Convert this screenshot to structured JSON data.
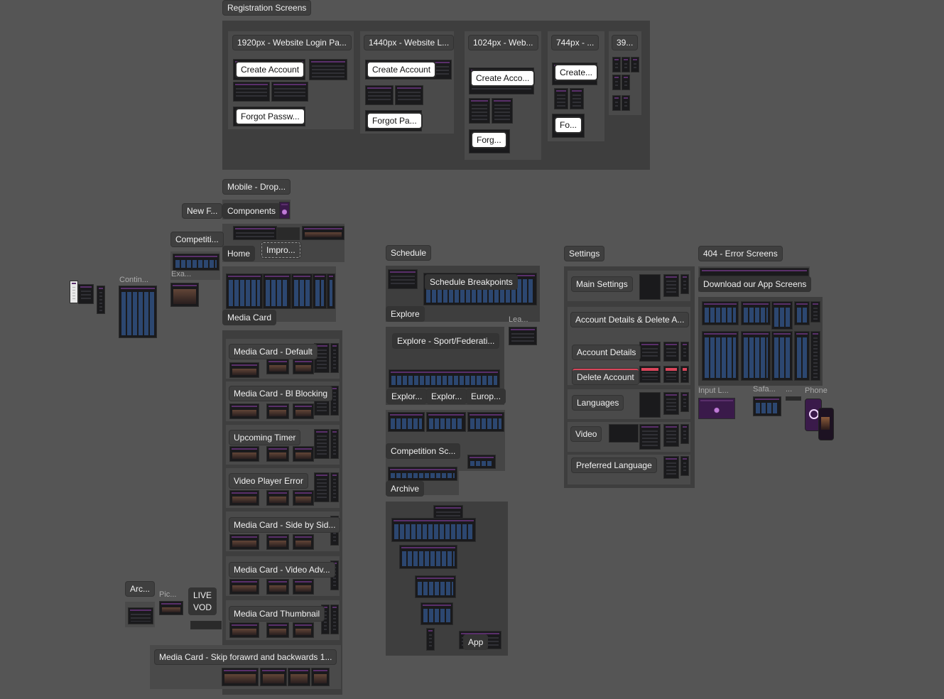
{
  "sections": {
    "registration": {
      "title": "Registration Screens",
      "frames": [
        {
          "title": "1920px - Website Login Pa...",
          "create": "Create Account",
          "forgot": "Forgot Passw..."
        },
        {
          "title": "1440px - Website L...",
          "create": "Create Account",
          "forgot": "Forgot Pa..."
        },
        {
          "title": "1024px - Web...",
          "create": "Create Acco...",
          "forgot": "Forg..."
        },
        {
          "title": "744px - ...",
          "create": "Create...",
          "forgot": "Fo..."
        },
        {
          "title": "39..."
        }
      ]
    },
    "components": {
      "mobile_drop": "Mobile - Drop...",
      "new_f": "New F...",
      "components": "Components",
      "competiti": "Competiti...",
      "home": "Home",
      "impro": "Impro...",
      "exa": "Exa...",
      "contin": "Contin...",
      "media_card": "Media Card",
      "media_card_groups": [
        "Media Card - Default",
        "Media Card - Bl Blocking",
        "Upcoming Timer",
        "Video Player Error",
        "Media Card - Side by Sid...",
        "Media Card - Video Adv...",
        "Media Card Thumbnail"
      ],
      "skip_card": "Media Card - Skip forawrd and backwards 1...",
      "arc": "Arc...",
      "pic": "Pic...",
      "live": "LIVE",
      "vod": "VOD"
    },
    "schedule": {
      "title": "Schedule",
      "breakpoints": "Schedule Breakpoints",
      "explore": "Explore",
      "lea": "Lea...",
      "explore_sport": "Explore - Sport/Federati...",
      "explor1": "Explor...",
      "explor2": "Explor...",
      "europ": "Europ...",
      "competition": "Competition Sc...",
      "archive": "Archive",
      "app": "App"
    },
    "settings": {
      "title": "Settings",
      "items": [
        "Main Settings",
        "Account Details & Delete A...",
        "Account Details",
        "Delete Account",
        "Languages",
        "Video",
        "Preferred Language"
      ]
    },
    "errors": {
      "title": "404 - Error Screens",
      "download": "Download our App Screens",
      "input": "Input L...",
      "safa": "Safa...",
      "dots": "...",
      "phone": "Phone"
    }
  },
  "colors": {
    "canvas": "#555555",
    "section": "#3e3e3e",
    "accent": "#5a2f6b",
    "danger": "#d9455a"
  }
}
